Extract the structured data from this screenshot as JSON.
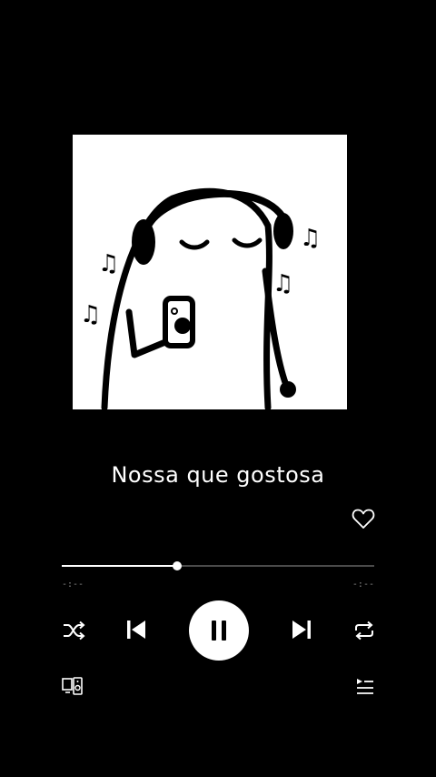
{
  "track": {
    "title": "Nossa que gostosa",
    "progress_fraction": 0.37
  },
  "time": {
    "elapsed": "-:--",
    "remaining": "-:--"
  },
  "icons": {
    "like": "heart-outline-icon",
    "shuffle": "shuffle-icon",
    "previous": "skip-previous-icon",
    "play_pause": "pause-icon",
    "next": "skip-next-icon",
    "repeat": "repeat-icon",
    "devices": "devices-icon",
    "queue": "queue-icon"
  },
  "colors": {
    "background": "#000000",
    "foreground": "#ffffff",
    "track": "#4a4a4a",
    "muted_text": "#8a8a8a"
  }
}
